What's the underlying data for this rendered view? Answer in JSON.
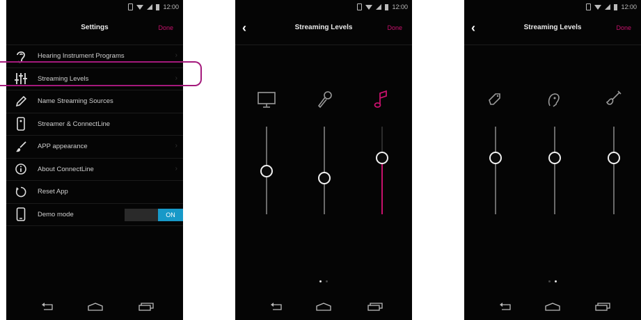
{
  "status_time": "12:00",
  "settings": {
    "title": "Settings",
    "done": "Done",
    "items": [
      {
        "label": "Hearing Instrument Programs",
        "icon": "ear-icon"
      },
      {
        "label": "Streaming Levels",
        "icon": "sliders-icon"
      },
      {
        "label": "Name Streaming Sources",
        "icon": "pen-icon"
      },
      {
        "label": "Streamer & ConnectLine",
        "icon": "streamer-icon"
      },
      {
        "label": "APP appearance",
        "icon": "brush-icon"
      },
      {
        "label": "About ConnectLine",
        "icon": "info-icon"
      },
      {
        "label": "Reset App",
        "icon": "reset-icon"
      },
      {
        "label": "Demo mode",
        "icon": "phone-icon"
      }
    ],
    "demo_toggle": "ON"
  },
  "streaming1": {
    "title": "Streaming Levels",
    "done": "Done",
    "sliders": [
      {
        "icon": "tv-icon",
        "level": 0.5,
        "active": false
      },
      {
        "icon": "microphone-icon",
        "level": 0.42,
        "active": false
      },
      {
        "icon": "music-note-icon",
        "level": 0.65,
        "active": true
      }
    ],
    "page": 1
  },
  "streaming2": {
    "title": "Streaming Levels",
    "done": "Done",
    "sliders": [
      {
        "icon": "tag-icon",
        "level": 0.65,
        "active": false
      },
      {
        "icon": "face-icon",
        "level": 0.65,
        "active": false
      },
      {
        "icon": "guitar-icon",
        "level": 0.65,
        "active": false
      }
    ],
    "page": 2
  },
  "colors": {
    "accent": "#c8116d",
    "toggle_on": "#1799c8",
    "highlight": "#a4197c"
  }
}
